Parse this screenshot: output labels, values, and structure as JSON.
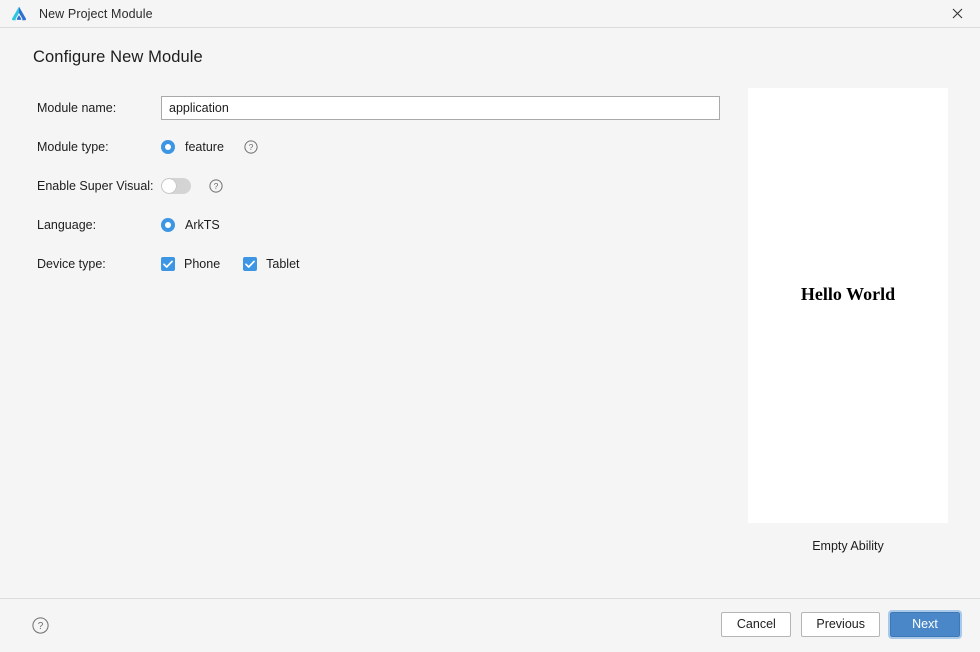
{
  "window": {
    "title": "New Project Module",
    "logo_icon": "deveco-logo-icon",
    "close_icon": "close-icon"
  },
  "page": {
    "title": "Configure New Module"
  },
  "form": {
    "module_name": {
      "label": "Module name:",
      "value": "application",
      "placeholder": ""
    },
    "module_type": {
      "label": "Module type:",
      "selected": "feature",
      "help_icon": "help-circle-icon"
    },
    "enable_super_visual": {
      "label": "Enable Super Visual:",
      "state": "off",
      "help_icon": "help-circle-icon"
    },
    "language": {
      "label": "Language:",
      "selected": "ArkTS"
    },
    "device_type": {
      "label": "Device type:",
      "options": [
        {
          "label": "Phone",
          "checked": true
        },
        {
          "label": "Tablet",
          "checked": true
        }
      ]
    }
  },
  "preview": {
    "screen_text": "Hello World",
    "caption": "Empty Ability"
  },
  "footer": {
    "help_icon": "help-circle-icon",
    "cancel_label": "Cancel",
    "previous_label": "Previous",
    "next_label": "Next"
  },
  "colors": {
    "accent": "#3d96e4",
    "primary_button": "#4a87c8",
    "window_bg": "#f5f5f5",
    "border": "#dcdcdc"
  }
}
